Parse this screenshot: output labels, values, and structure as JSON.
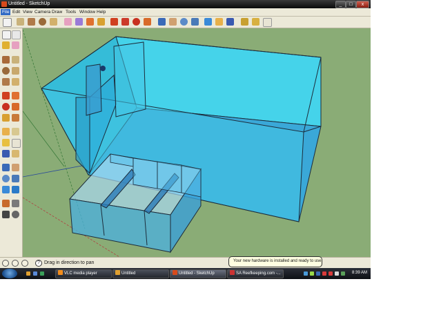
{
  "window": {
    "title": "Untitled - SketchUp",
    "controls": {
      "minimize": "_",
      "maximize": "□",
      "close": "x"
    }
  },
  "menubar": {
    "items": [
      {
        "label": "File",
        "active": true
      },
      {
        "label": "Edit"
      },
      {
        "label": "View"
      },
      {
        "label": "Camera"
      },
      {
        "label": "Draw"
      },
      {
        "label": "Tools"
      },
      {
        "label": "Window"
      },
      {
        "label": "Help"
      }
    ]
  },
  "toolbar": {
    "icons": [
      "select-icon",
      "pencil-icon",
      "rectangle-icon",
      "circle-icon",
      "arc-icon",
      "eraser-icon",
      "paint-bucket-icon",
      "push-pull-icon",
      "move-icon",
      "rotate-icon",
      "follow-me-icon",
      "offset-icon",
      "orbit-icon",
      "pan-icon",
      "zoom-icon",
      "zoom-window-icon",
      "zoom-extents-icon",
      "tape-measure-icon",
      "axes-icon",
      "text-icon",
      "component-icon",
      "warehouse-icon",
      "get-models-icon",
      "share-model-icon"
    ]
  },
  "status": {
    "text": "Drag in direction to pan",
    "help": "?"
  },
  "notification": {
    "text": "Your new hardware is installed and ready to use."
  },
  "taskbar": {
    "tasks": [
      {
        "label": "VLC media player",
        "color": "#f28c1b"
      },
      {
        "label": "Untitled",
        "color": "#e0a030"
      },
      {
        "label": "Untitled - SketchUp",
        "color": "#d84a1b"
      },
      {
        "label": "SA Reefkeeping.com -...",
        "color": "#cc3333"
      }
    ],
    "clock": "8:39 AM"
  },
  "colors": {
    "viewport_bg": "#8aac76",
    "glass": "#46d4ea",
    "glass_dark": "#2a9cc7",
    "edge": "#1c2b3a"
  }
}
